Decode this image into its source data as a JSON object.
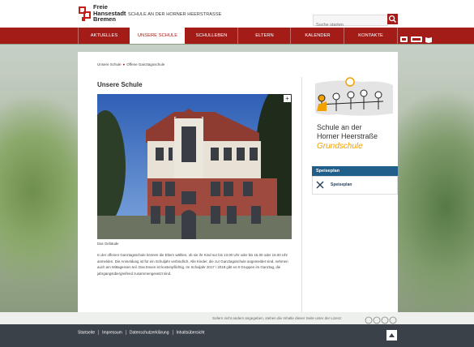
{
  "header": {
    "logo_lines": [
      "Freie",
      "Hansestadt",
      "Bremen"
    ],
    "school_name": "SCHULE AN DER HORNER HEERSTRASSE",
    "search_placeholder": "Suche starten"
  },
  "nav": {
    "items": [
      {
        "label": "AKTUELLES",
        "active": false
      },
      {
        "label": "UNSERE SCHULE",
        "active": true
      },
      {
        "label": "SCHULLEBEN",
        "active": false
      },
      {
        "label": "ELTERN",
        "active": false
      },
      {
        "label": "KALENDER",
        "active": false
      },
      {
        "label": "KONTAKTE",
        "active": false
      }
    ],
    "util_icons": [
      "sign-language-icon",
      "easy-language-icon",
      "book-icon"
    ]
  },
  "breadcrumb": [
    "Unsere Schule",
    "Offene Ganztagsschule"
  ],
  "main": {
    "title": "Unsere Schule",
    "image_caption": "Das Gebäude",
    "expand_label": "+",
    "paragraphs": [
      "In der offenen Ganztagsschule können die Eltern wählen, ob sie ihr Kind nur bis 13.00 Uhr oder bis 15.00 oder 16.00 Uhr anmelden. Die Anmeldung ist für ein Schuljahr verbindlich. Alle Kinder, die zur Ganztagsschule angemeldet sind, nehmen auch am Mittagessen teil. Das Essen ist kostenpflichtig.",
      "Im Schuljahr 2017 / 2018 gibt es 8 Gruppen im Ganztag, die jahrgangsübergreifend zusammengesetzt sind."
    ]
  },
  "sidebar": {
    "school_logo_lines": [
      "Schule an der",
      "Horner Heerstraße",
      "Grundschule"
    ],
    "panel_title": "Speiseplan",
    "panel_item": "Speiseplan"
  },
  "footer": {
    "license_note": "Sofern nicht anders angegeben, stehen die Inhalte dieser Seite unter der Lizenz",
    "links": [
      "Startseite",
      "Impressum",
      "Datenschutzerklärung",
      "Inhaltsübersicht"
    ]
  },
  "colors": {
    "brand_red": "#a31c18",
    "panel_blue": "#1f5f8a",
    "logo_orange": "#f2a100"
  }
}
